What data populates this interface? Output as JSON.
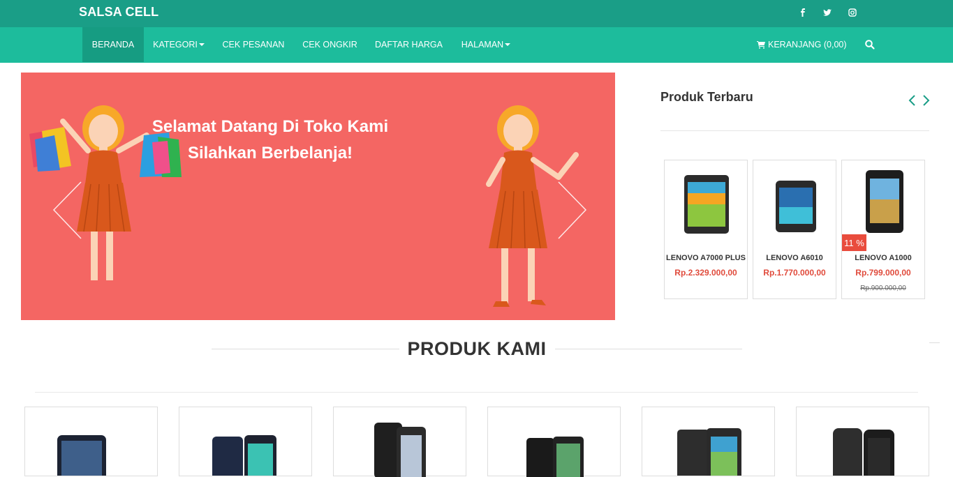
{
  "topbar": {
    "brand": "SALSA CELL",
    "social": [
      "facebook-icon",
      "twitter-icon",
      "instagram-icon"
    ]
  },
  "nav": {
    "items": [
      {
        "label": "BERANDA",
        "active": true
      },
      {
        "label": "KATEGORI",
        "dropdown": true
      },
      {
        "label": "CEK PESANAN"
      },
      {
        "label": "CEK ONGKIR"
      },
      {
        "label": "DAFTAR HARGA"
      },
      {
        "label": "HALAMAN",
        "dropdown": true
      }
    ],
    "cart_label": "KERANJANG (0,00)"
  },
  "slider": {
    "line1": "Selamat Datang Di Toko Kami",
    "line2": "Silahkan Berbelanja!",
    "bg_color": "#f46663"
  },
  "latest": {
    "title": "Produk Terbaru",
    "products": [
      {
        "name": "LENOVO A7000 PLUS",
        "price": "Rp.2.329.000,00"
      },
      {
        "name": "LENOVO A6010",
        "price": "Rp.1.770.000,00"
      },
      {
        "name": "LENOVO A1000",
        "price": "Rp.799.000,00",
        "old_price": "Rp.900.000,00",
        "badge": "11 %"
      }
    ]
  },
  "products_section": {
    "title": "PRODUK KAMI"
  },
  "colors": {
    "topbar": "#1a9e87",
    "navbar": "#1dbc9c",
    "nav_active": "#169c82",
    "price": "#e04b3c"
  }
}
